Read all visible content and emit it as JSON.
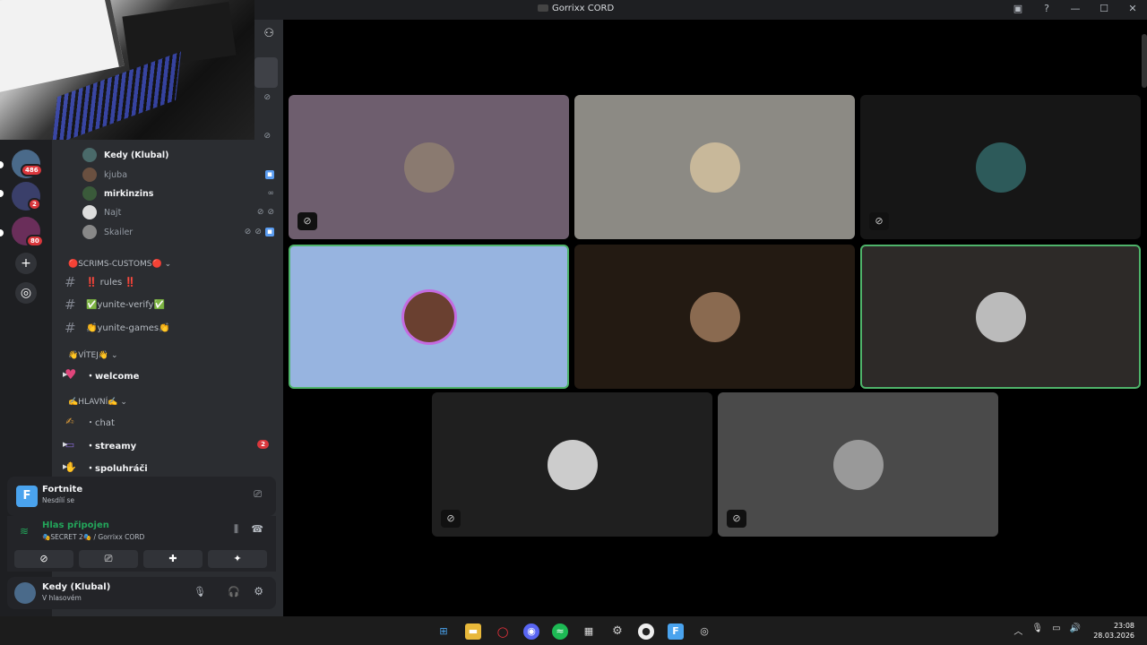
{
  "window": {
    "title": "Gorrixx CORD"
  },
  "guilds": {
    "badges": [
      "486",
      "2",
      "80"
    ]
  },
  "voice_users": [
    {
      "name": "Kedy (Klubal)",
      "bold": true
    },
    {
      "name": "kjuba",
      "bold": false
    },
    {
      "name": "mirkinzins",
      "bold": true
    },
    {
      "name": "Najt",
      "bold": false
    },
    {
      "name": "Skailer",
      "bold": false
    }
  ],
  "categories": {
    "scrims": "🔴SCRIMS-CUSTOMS🔴",
    "vitej": "👋VÍTEJ👋",
    "hlavni": "✍️HLAVNÍ✍️"
  },
  "channels": {
    "rules": "‼️ rules ‼️",
    "yunite_verify": "✅yunite-verify✅",
    "yunite_games": "👏yunite-games👏",
    "welcome": "・welcome",
    "chat": "・chat",
    "streamy": "・streamy",
    "streamy_count": "2",
    "spoluhraci": "・spoluhráči"
  },
  "activity": {
    "game": "Fortnite",
    "status": "Nesdílí se"
  },
  "voice_panel": {
    "status": "Hlas připojen",
    "channel": "🎭SECRET 2🎭 / Gorrixx CORD"
  },
  "user": {
    "name": "Kedy (Klubal)",
    "status": "V hlasovém"
  },
  "colors": {
    "accent_green": "#23a55a",
    "badge_red": "#da373c",
    "speaking_border": "#4eb36a"
  },
  "taskbar": {
    "time": "23:08",
    "date": "28.03.2026"
  }
}
